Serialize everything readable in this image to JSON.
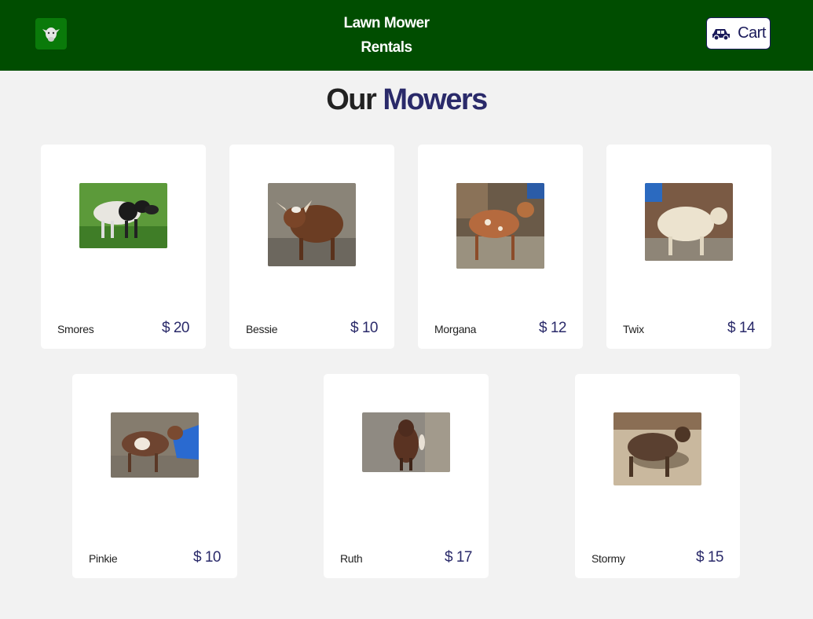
{
  "header": {
    "brand_line1": "Lawn Mower",
    "brand_line2": "Rentals",
    "logo_icon": "goat-icon",
    "cart_label": "Cart",
    "cart_icon": "car-icon",
    "bg_color": "#004d00"
  },
  "page": {
    "title_part1": "Our",
    "title_part2": "Mowers",
    "accent_color": "#2a2a6a"
  },
  "products": [
    {
      "name": "Smores",
      "price": "$ 20"
    },
    {
      "name": "Bessie",
      "price": "$ 10"
    },
    {
      "name": "Morgana",
      "price": "$ 12"
    },
    {
      "name": "Twix",
      "price": "$ 14"
    },
    {
      "name": "Pinkie",
      "price": "$ 10"
    },
    {
      "name": "Ruth",
      "price": "$ 17"
    },
    {
      "name": "Stormy",
      "price": "$ 15"
    }
  ]
}
